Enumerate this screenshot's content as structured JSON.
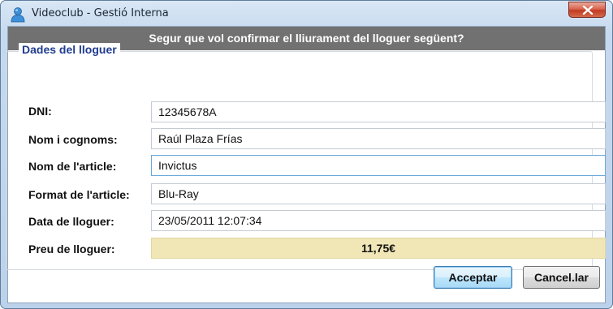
{
  "window": {
    "title": "Videoclub - Gestió Interna"
  },
  "banner": "Segur que vol confirmar el lliurament del lloguer següent?",
  "section": {
    "legend": "Dades del lloguer"
  },
  "fields": {
    "dni": {
      "label": "DNI:",
      "value": "12345678A"
    },
    "name": {
      "label": "Nom i cognoms:",
      "value": "Raúl Plaza Frías"
    },
    "article": {
      "label": "Nom de l'article:",
      "value": "Invictus"
    },
    "format": {
      "label": "Format de l'article:",
      "value": "Blu-Ray"
    },
    "date": {
      "label": "Data de lloguer:",
      "value": "23/05/2011 12:07:34"
    },
    "price": {
      "label": "Preu de lloguer:",
      "value": "11,75€"
    }
  },
  "buttons": {
    "accept": "Acceptar",
    "cancel": "Cancel.lar"
  },
  "colors": {
    "banner": "#717171",
    "legend": "#1f3c8f",
    "price_bg": "#f1e7b6",
    "close": "#c23b22"
  },
  "icons": {
    "app": "user-icon",
    "close": "close-icon"
  }
}
